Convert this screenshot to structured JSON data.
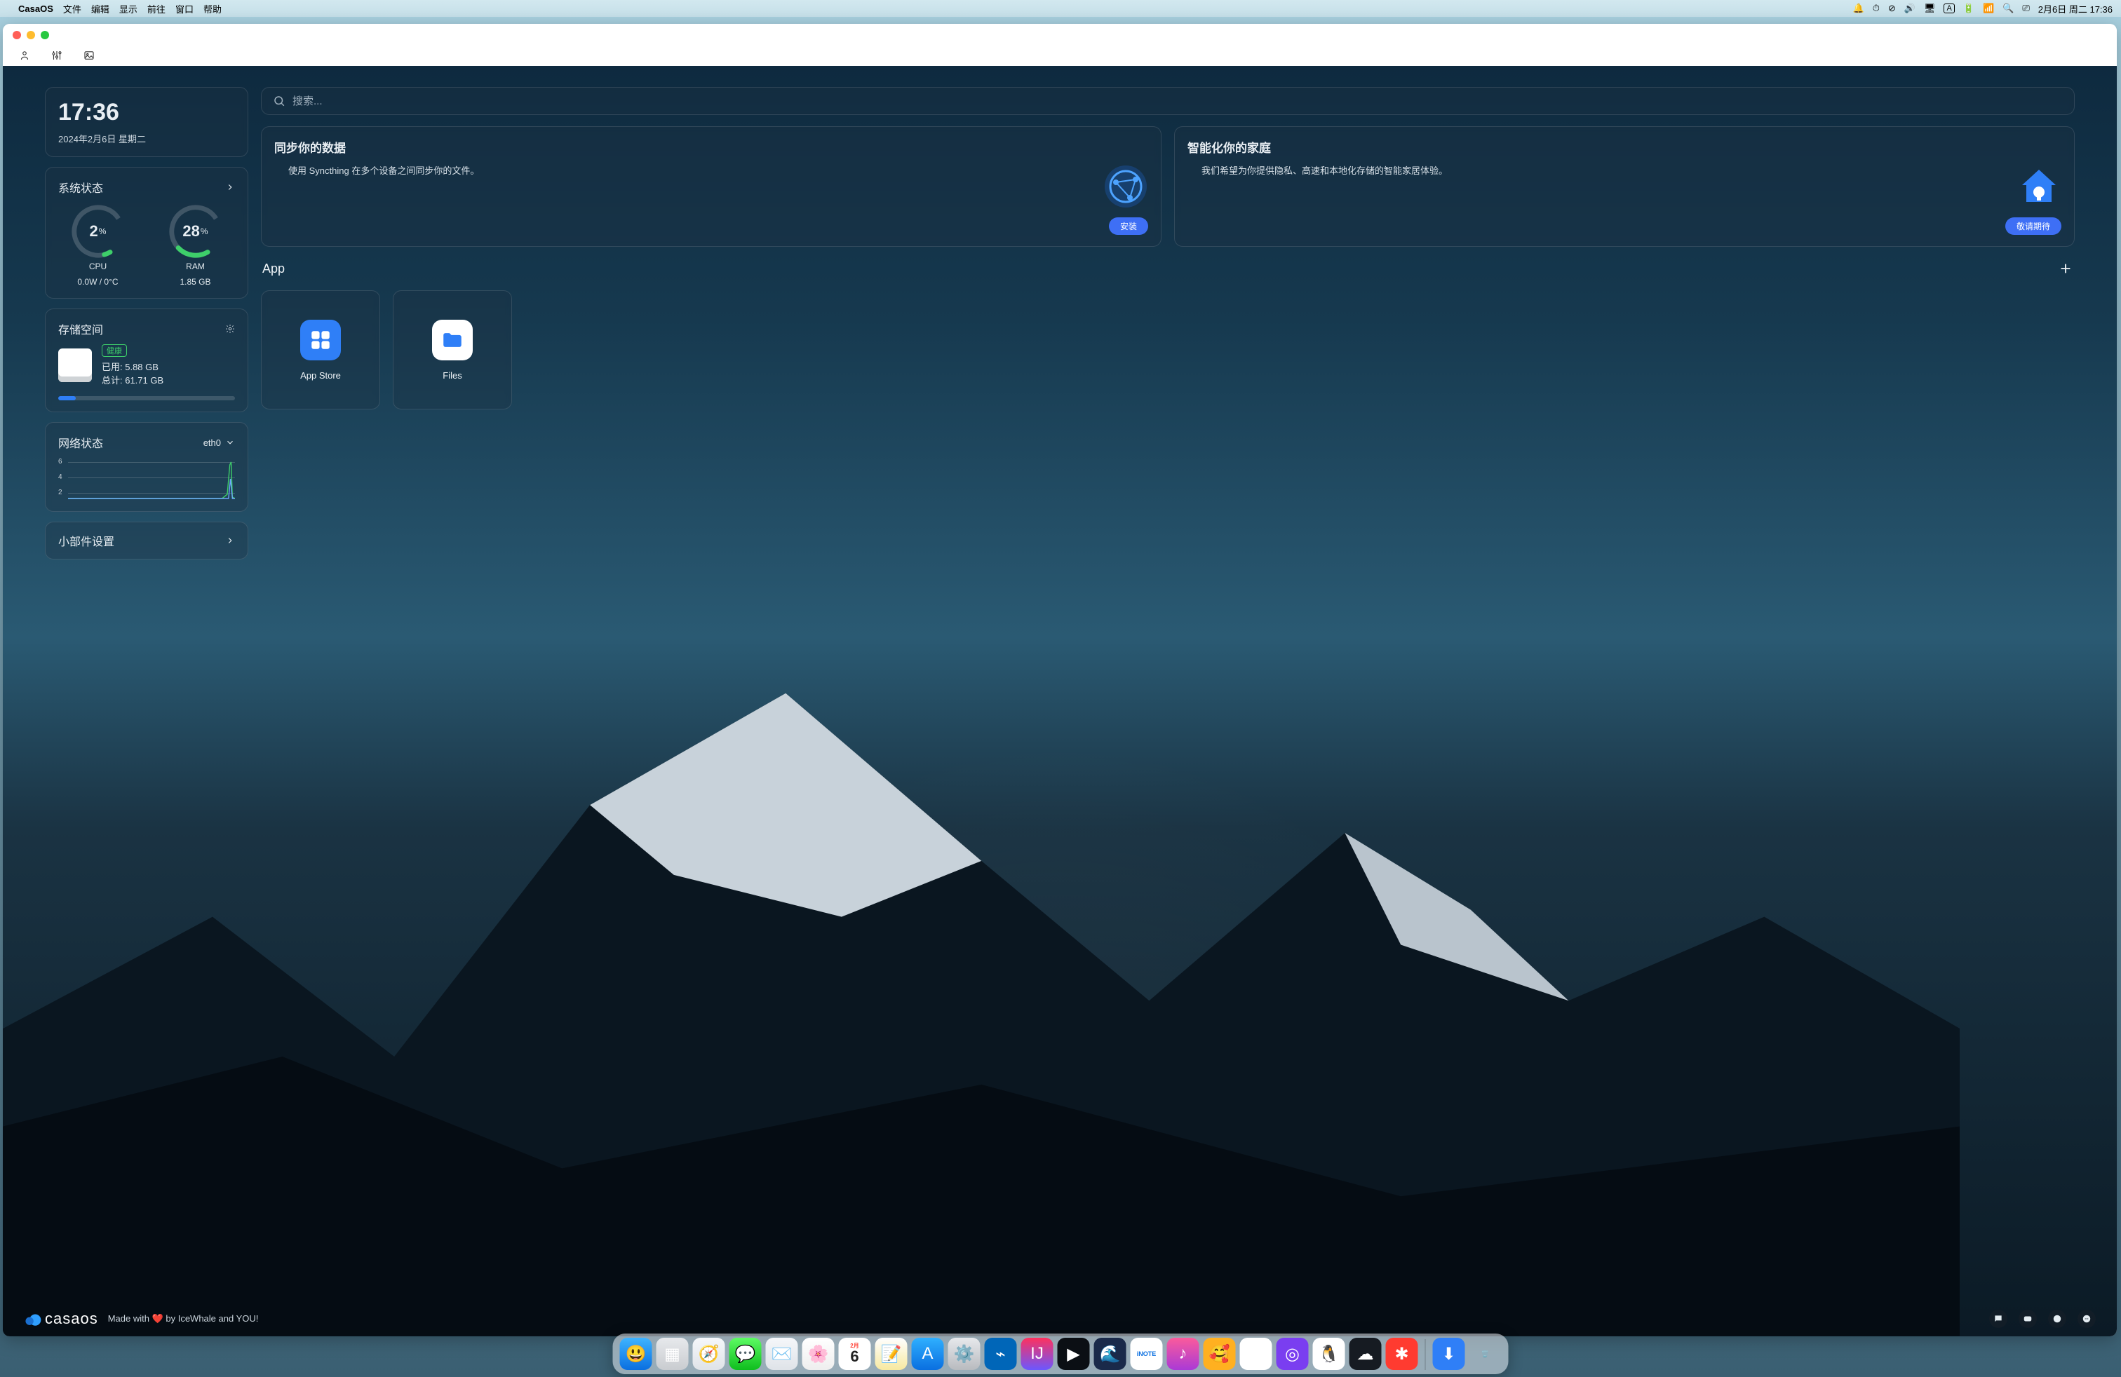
{
  "menubar": {
    "app_name": "CasaOS",
    "items": [
      "文件",
      "编辑",
      "显示",
      "前往",
      "窗口",
      "帮助"
    ],
    "date_time": "2月6日 周二  17:36"
  },
  "toolbar_icons": [
    "user-icon",
    "sliders-icon",
    "image-icon"
  ],
  "clock": {
    "time": "17:36",
    "date": "2024年2月6日 星期二"
  },
  "system_status": {
    "title": "系统状态",
    "cpu": {
      "value": 2,
      "unit": "%",
      "label": "CPU",
      "sub": "0.0W / 0°C",
      "fill_pct": 5
    },
    "ram": {
      "value": 28,
      "unit": "%",
      "label": "RAM",
      "sub": "1.85 GB",
      "fill_pct": 28
    }
  },
  "storage": {
    "title": "存储空间",
    "health_badge": "健康",
    "used_label": "已用: 5.88 GB",
    "total_label": "总计: 61.71 GB",
    "pct": 10
  },
  "network": {
    "title": "网络状态",
    "iface": "eth0",
    "y_ticks": [
      "6",
      "4",
      "2"
    ]
  },
  "widgets": {
    "title": "小部件设置"
  },
  "search": {
    "placeholder": "搜索..."
  },
  "promos": [
    {
      "title": "同步你的数据",
      "desc": "使用 Syncthing 在多个设备之间同步你的文件。",
      "button": "安装",
      "icon": "syncthing"
    },
    {
      "title": "智能化你的家庭",
      "desc": "我们希望为你提供隐私、高速和本地化存储的智能家居体验。",
      "button": "敬请期待",
      "icon": "home"
    }
  ],
  "apps_section": {
    "title": "App"
  },
  "apps": [
    {
      "label": "App Store",
      "icon_color": "#2f7ff7",
      "glyph": "grid"
    },
    {
      "label": "Files",
      "icon_color": "#ffffff",
      "glyph": "folder"
    }
  ],
  "footer": {
    "logo": "casaos",
    "text": "Made with ❤️ by IceWhale and YOU!"
  },
  "dock": [
    {
      "name": "finder",
      "bg": "linear-gradient(#3fb4ff,#0a6fe0)",
      "glyph": "😃"
    },
    {
      "name": "launchpad",
      "bg": "linear-gradient(#e7e9ec,#c9ccd0)",
      "glyph": "▦"
    },
    {
      "name": "safari",
      "bg": "linear-gradient(#f5f7fa,#dfe3e8)",
      "glyph": "🧭"
    },
    {
      "name": "messages",
      "bg": "linear-gradient(#5dfb63,#0fbe1e)",
      "glyph": "💬"
    },
    {
      "name": "mail",
      "bg": "linear-gradient(#f5f7fa,#dfe3e8)",
      "glyph": "✉️"
    },
    {
      "name": "photos",
      "bg": "linear-gradient(#fff,#eee)",
      "glyph": "🌸"
    },
    {
      "name": "calendar",
      "bg": "#fff",
      "glyph": "6",
      "top": "2月"
    },
    {
      "name": "notes",
      "bg": "linear-gradient(#fff,#f7e9a0)",
      "glyph": "📝"
    },
    {
      "name": "appstore",
      "bg": "linear-gradient(#2fb0ff,#0a6fe0)",
      "glyph": "A"
    },
    {
      "name": "settings",
      "bg": "linear-gradient(#e7e9ec,#b8bbbf)",
      "glyph": "⚙️"
    },
    {
      "name": "vscode",
      "bg": "#0066b8",
      "glyph": "⌁"
    },
    {
      "name": "intellij",
      "bg": "linear-gradient(#fe315d,#6b57ff)",
      "glyph": "IJ"
    },
    {
      "name": "term1",
      "bg": "#0b0f14",
      "glyph": "▶"
    },
    {
      "name": "wave",
      "bg": "#1a2a4a",
      "glyph": "🌊"
    },
    {
      "name": "inote",
      "bg": "#fff",
      "glyph": "iNOTE"
    },
    {
      "name": "music",
      "bg": "linear-gradient(#fb5b9b,#aa3ad6)",
      "glyph": "♪"
    },
    {
      "name": "emoji",
      "bg": "#ffb020",
      "glyph": "🥰"
    },
    {
      "name": "edge",
      "bg": "#fff",
      "glyph": "◑"
    },
    {
      "name": "purple-app",
      "bg": "#7a3ef0",
      "glyph": "◎"
    },
    {
      "name": "qq",
      "bg": "#fff",
      "glyph": "🐧"
    },
    {
      "name": "cloud-app",
      "bg": "#161b22",
      "glyph": "☁"
    },
    {
      "name": "red-app",
      "bg": "#ff3b30",
      "glyph": "✱"
    },
    {
      "name": "downloads",
      "bg": "#2f7ff7",
      "glyph": "⬇"
    },
    {
      "name": "trash",
      "bg": "transparent",
      "glyph": "🗑️"
    }
  ]
}
